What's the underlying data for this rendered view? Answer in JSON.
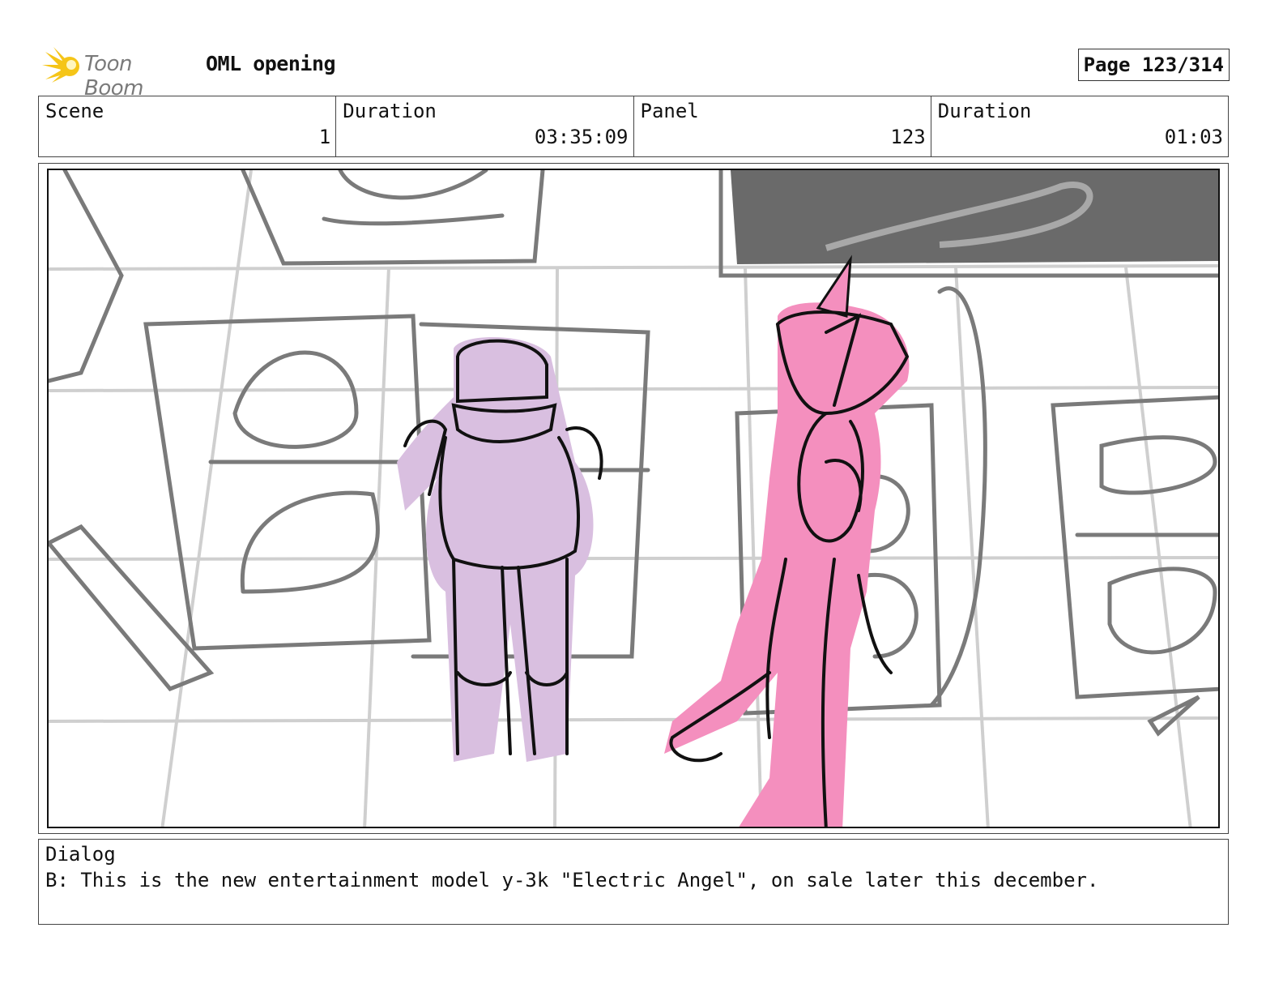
{
  "header": {
    "logo_text": "Toon Boom",
    "project_title": "OML opening",
    "page_label": "Page 123/314"
  },
  "info": {
    "scene_label": "Scene",
    "scene_value": "1",
    "duration_label": "Duration",
    "duration_value": "03:35:09",
    "panel_label": "Panel",
    "panel_value": "123",
    "panel_duration_label": "Duration",
    "panel_duration_value": "01:03"
  },
  "colors": {
    "sketch_gray": "#7a7a7a",
    "lavender_figure": "#d9bfe0",
    "pink_figure": "#f48fbe",
    "screen_dark": "#6a6a6a",
    "logo_yellow": "#f5c518"
  },
  "dialog": {
    "label": "Dialog",
    "text": "B: This is the new entertainment model y-3k \"Electric Angel\", on sale later this december."
  }
}
